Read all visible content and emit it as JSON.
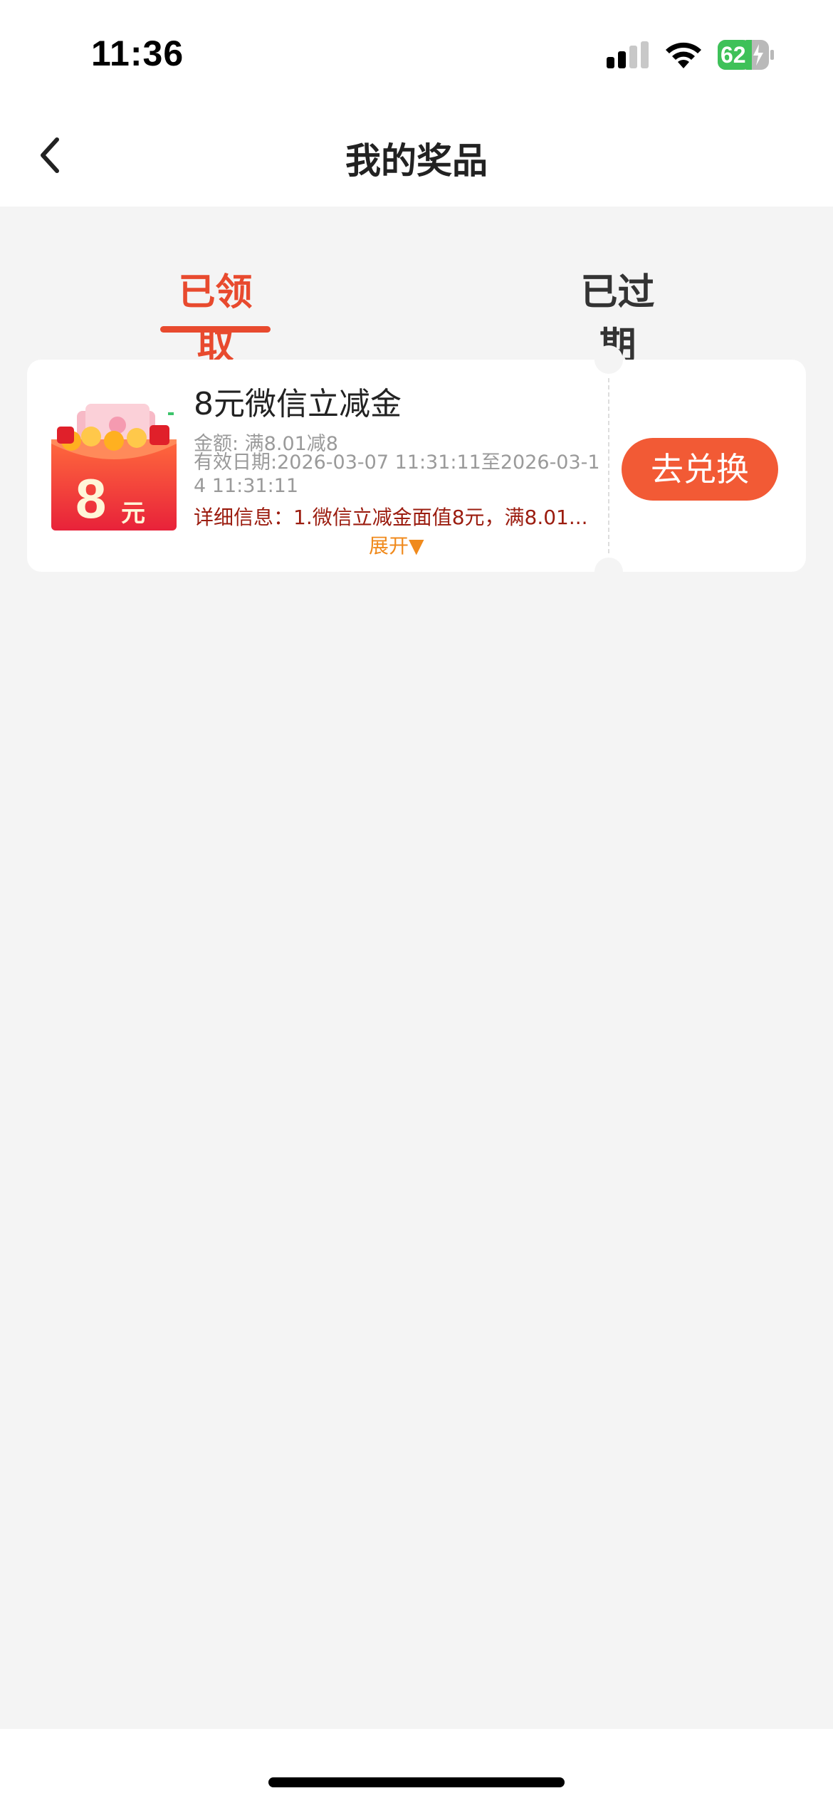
{
  "status_bar": {
    "time": "11:36",
    "battery_level": "62"
  },
  "nav": {
    "title": "我的奖品",
    "back_icon": "chevron-left-icon"
  },
  "tabs": [
    {
      "label": "已领取",
      "active": true
    },
    {
      "label": "已过期",
      "active": false
    }
  ],
  "prize": {
    "image_label": "8",
    "image_unit": "元",
    "title": "8元微信立减金",
    "amount": "金额: 满8.01减8",
    "validity": "有效日期:2026-03-07 11:31:11至2026-03-14 11:31:11",
    "detail": "详细信息：1.微信立减金面值8元，满8.01...",
    "expand_label": "展开▼",
    "redeem_label": "去兑换"
  },
  "colors": {
    "accent": "#e84a2e",
    "button": "#f25a35",
    "detail_text": "#9b1c0f",
    "expand_text": "#f08a1c",
    "background": "#f4f4f4"
  }
}
